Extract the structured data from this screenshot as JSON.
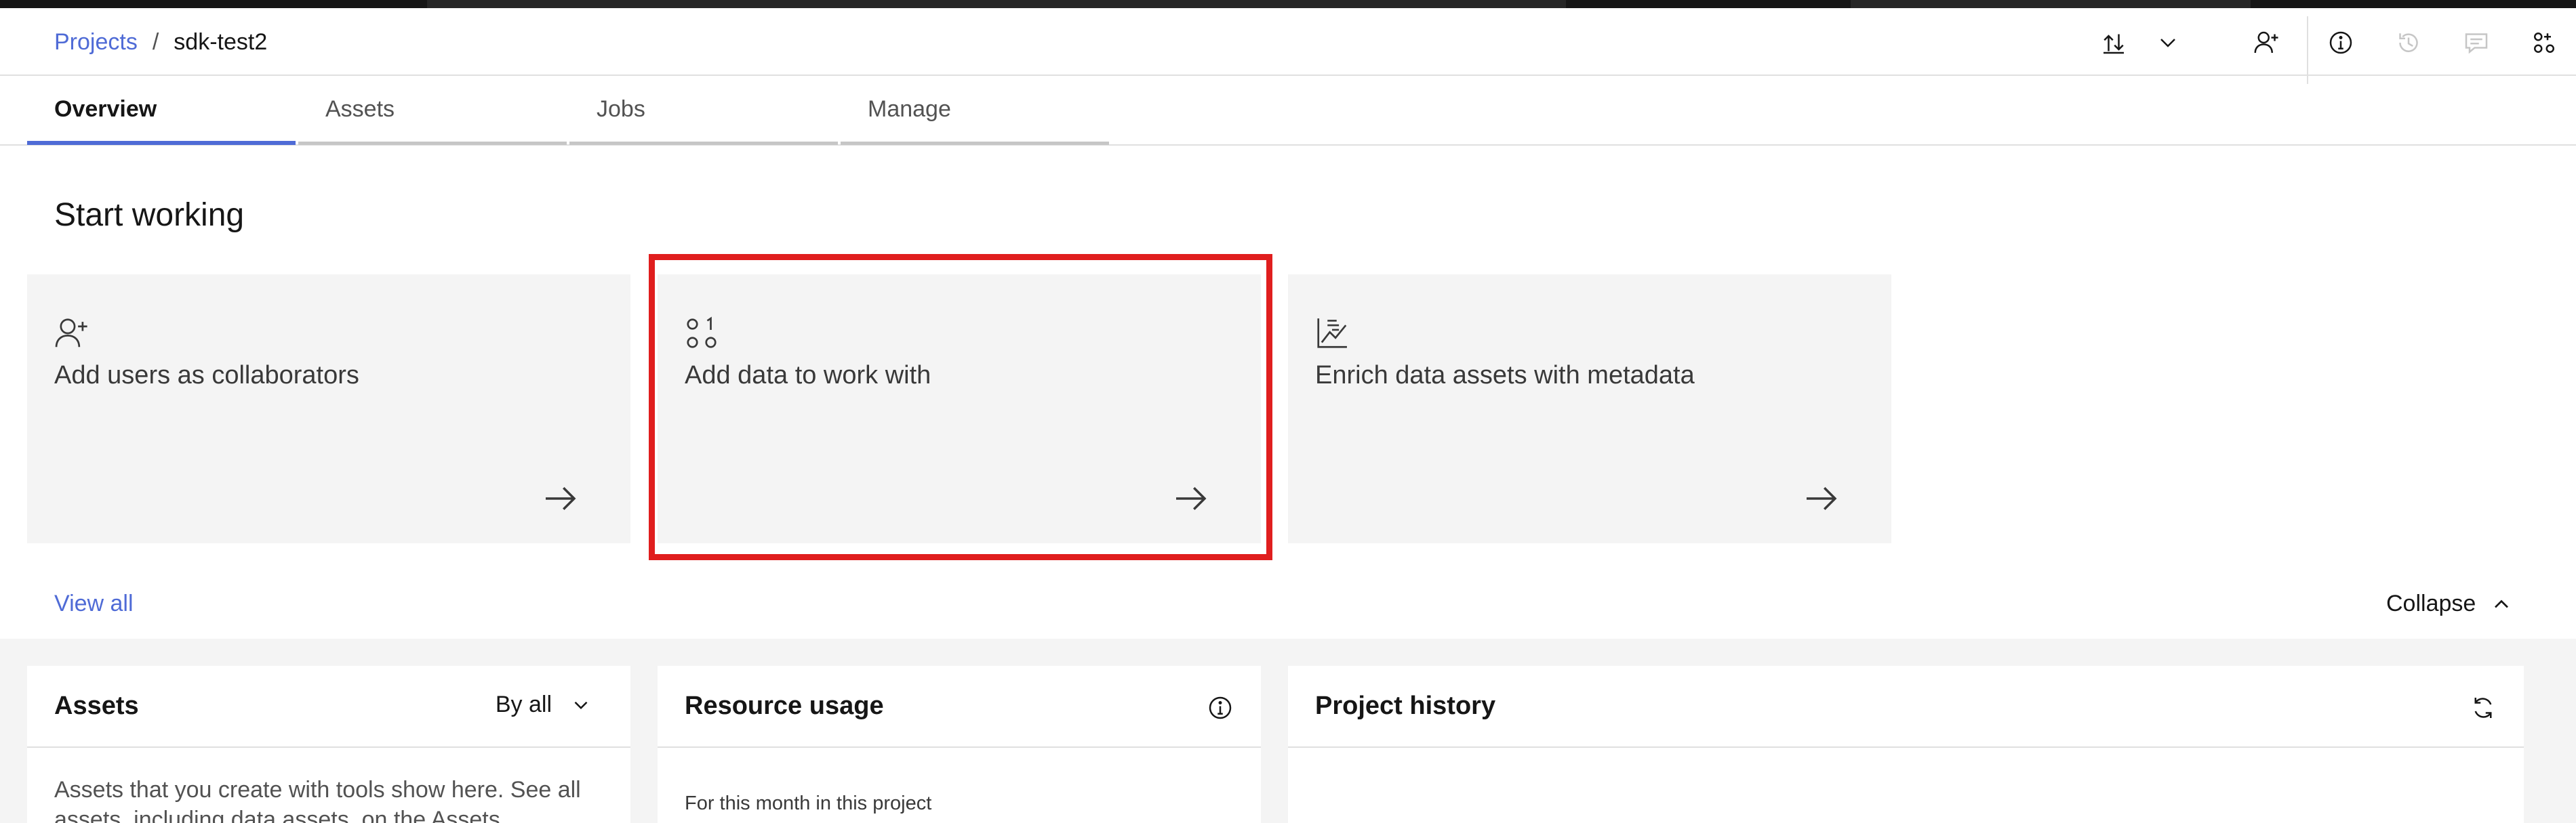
{
  "breadcrumb": {
    "parent": "Projects",
    "separator": "/",
    "current": "sdk-test2"
  },
  "header_icons": [
    "import-export-icon",
    "chevron-down-icon",
    "add-user-icon",
    "information-icon",
    "history-icon",
    "comment-icon",
    "apps-icon"
  ],
  "tabs": [
    {
      "label": "Overview",
      "active": true
    },
    {
      "label": "Assets",
      "active": false
    },
    {
      "label": "Jobs",
      "active": false
    },
    {
      "label": "Manage",
      "active": false
    }
  ],
  "start_working": {
    "title": "Start working",
    "tiles": [
      {
        "label": "Add users as collaborators",
        "icon": "add-user-icon"
      },
      {
        "label": "Add data to work with",
        "icon": "data-icon"
      },
      {
        "label": "Enrich data assets with metadata",
        "icon": "chart-enrich-icon"
      }
    ],
    "view_all": "View all",
    "collapse": "Collapse"
  },
  "cards": {
    "assets": {
      "title": "Assets",
      "filter": "By all",
      "body": "Assets that you create with tools show here. See all assets, including data assets, on the Assets"
    },
    "resource_usage": {
      "title": "Resource usage",
      "subtitle": "For this month in this project"
    },
    "project_history": {
      "title": "Project history"
    }
  },
  "colors": {
    "accent": "#4f6bd6",
    "highlight": "#e01e1e",
    "tile_bg": "#f4f4f4"
  }
}
